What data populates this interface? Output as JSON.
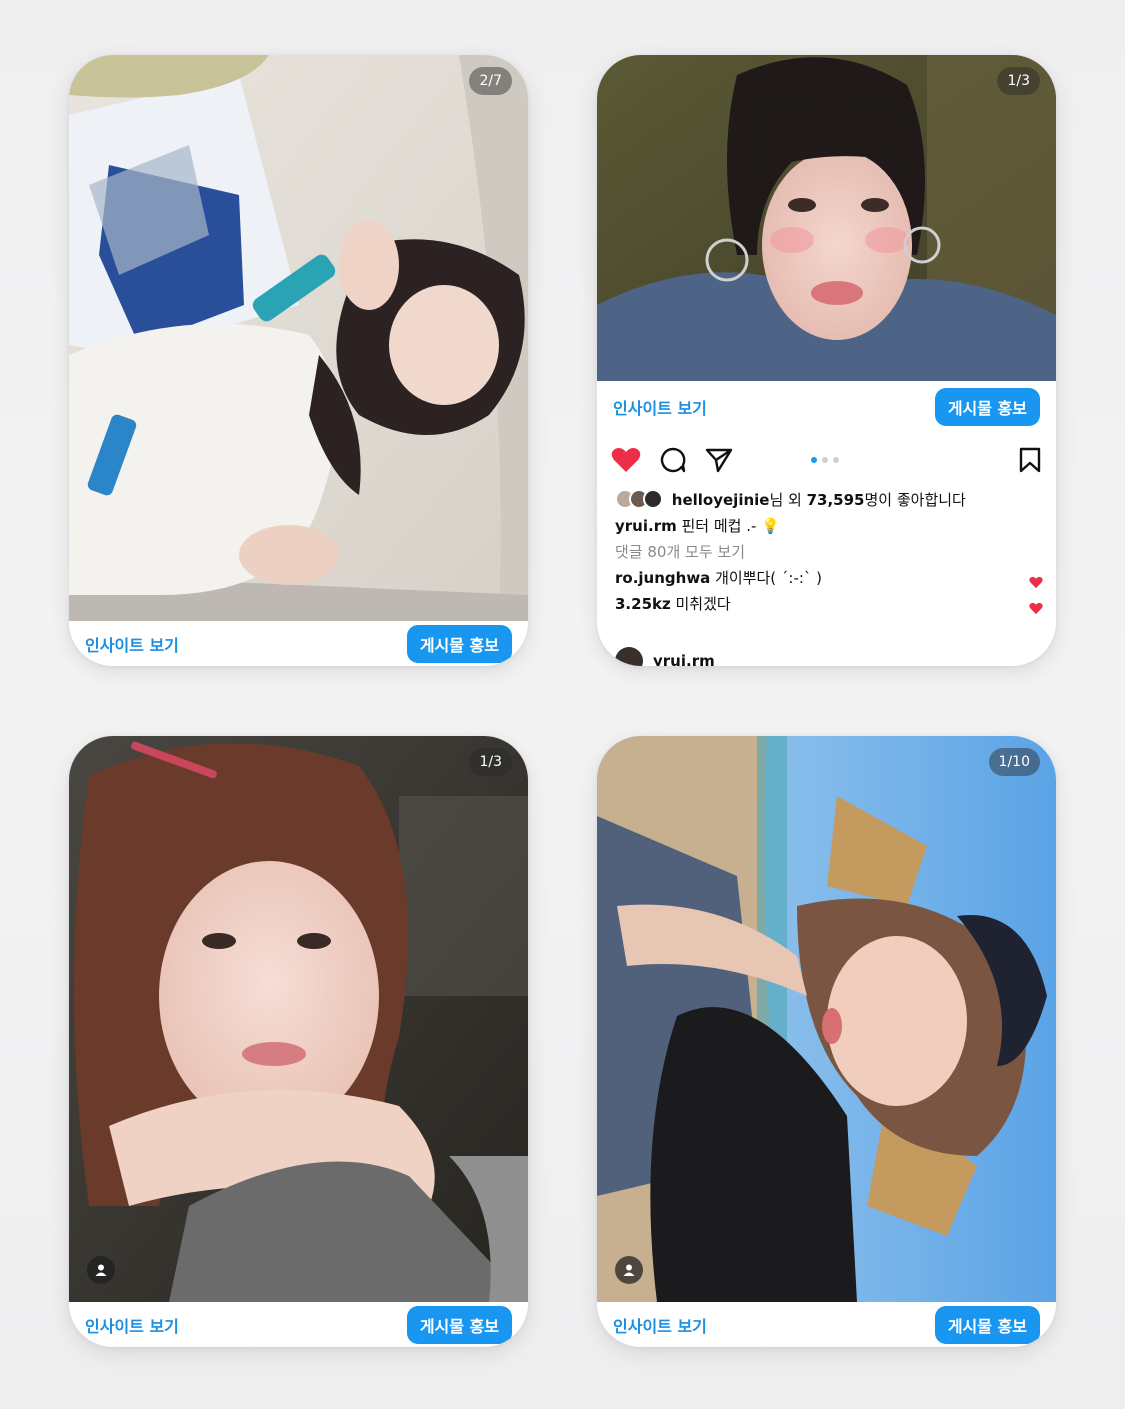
{
  "colors": {
    "accent": "#1996f0",
    "link": "#1a8fe3",
    "like_red": "#ee2d47"
  },
  "cards": [
    {
      "counter": "2/7",
      "insight_label": "인사이트 보기",
      "promote_label": "게시물 홍보"
    },
    {
      "counter": "1/3",
      "insight_label": "인사이트 보기",
      "promote_label": "게시물 홍보",
      "likes": {
        "liker": "helloyejinie",
        "suffix_1": "님 외 ",
        "count": "73,595",
        "suffix_2": "명이 좋아합니다"
      },
      "caption": {
        "user": "yrui.rm",
        "text": " 핀터 메컵 .- 💡"
      },
      "view_comments": "댓글 80개 모두 보기",
      "comments": [
        {
          "user": "ro.junghwa",
          "text": " 개이뿌다( ´:-:` )"
        },
        {
          "user": "3.25kz",
          "text": " 미취겠다"
        }
      ],
      "next_user": "yrui.rm"
    },
    {
      "counter": "1/3",
      "insight_label": "인사이트 보기",
      "promote_label": "게시물 홍보"
    },
    {
      "counter": "1/10",
      "insight_label": "인사이트 보기",
      "promote_label": "게시물 홍보"
    }
  ]
}
